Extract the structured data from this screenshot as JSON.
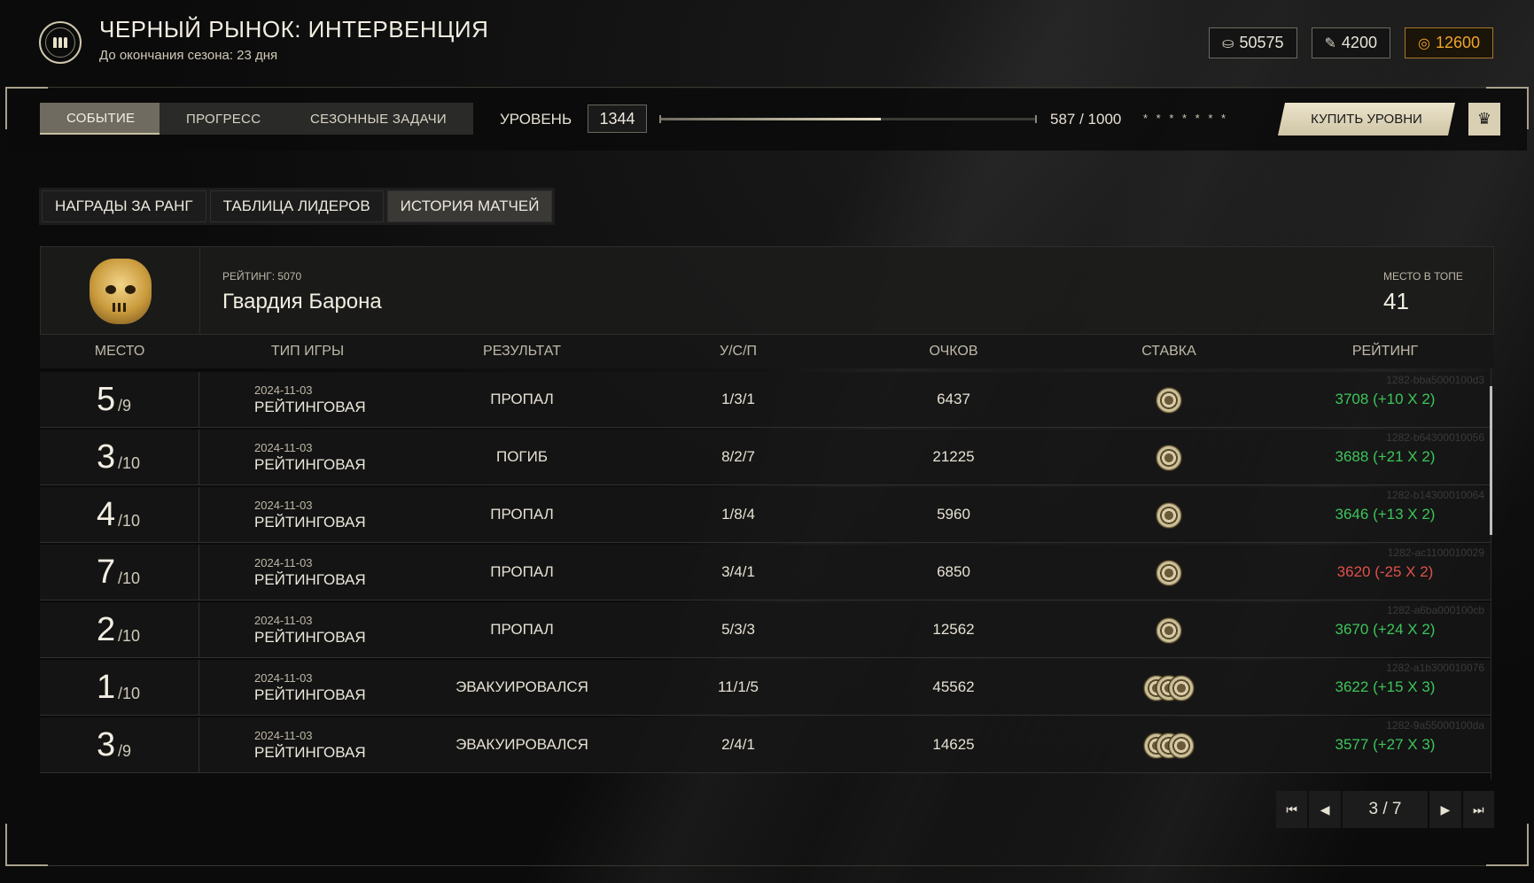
{
  "header": {
    "title": "ЧЕРНЫЙ РЫНОК: ИНТЕРВЕНЦИЯ",
    "subtitle": "До окончания сезона: 23 дня",
    "currencies": [
      {
        "icon": "tokens-icon",
        "value": "50575"
      },
      {
        "icon": "dogtag-icon",
        "value": "4200"
      },
      {
        "icon": "gold-coin-icon",
        "value": "12600",
        "color": "#f0a42c"
      }
    ]
  },
  "toolbar": {
    "tabs": [
      "СОБЫТИЕ",
      "ПРОГРЕСС",
      "СЕЗОННЫЕ ЗАДАЧИ"
    ],
    "active_tab": "СОБЫТИЕ",
    "level_label": "УРОВЕНЬ",
    "level_value": "1344",
    "progress_text": "587 / 1000",
    "progress_fraction": 0.587,
    "stars_text": "* * * * * * *",
    "buy_label": "КУПИТЬ УРОВНИ"
  },
  "subtabs": {
    "items": [
      "НАГРАДЫ ЗА РАНГ",
      "ТАБЛИЦА ЛИДЕРОВ",
      "ИСТОРИЯ МАТЧЕЙ"
    ],
    "active": "ИСТОРИЯ МАТЧЕЙ"
  },
  "profile": {
    "rating_label": "РЕЙТИНГ: 5070",
    "team_name": "Гвардия Барона",
    "place_label": "МЕСТО В ТОПЕ",
    "place_value": "41"
  },
  "table": {
    "headers": [
      "МЕСТО",
      "ТИП ИГРЫ",
      "РЕЗУЛЬТАТ",
      "У/С/П",
      "ОЧКОВ",
      "СТАВКА",
      "РЕЙТИНГ"
    ],
    "rows": [
      {
        "id": "1282-bba5000100d3",
        "place": "5",
        "total": "/9",
        "date": "2024-11-03",
        "type": "РЕЙТИНГОВАЯ",
        "result": "ПРОПАЛ",
        "ksa": "1/3/1",
        "score": "6437",
        "chips": 1,
        "rating": "3708 (+10 X 2)",
        "rating_positive": true
      },
      {
        "id": "1282-b64300010056",
        "place": "3",
        "total": "/10",
        "date": "2024-11-03",
        "type": "РЕЙТИНГОВАЯ",
        "result": "ПОГИБ",
        "ksa": "8/2/7",
        "score": "21225",
        "chips": 1,
        "rating": "3688 (+21 X 2)",
        "rating_positive": true
      },
      {
        "id": "1282-b14300010064",
        "place": "4",
        "total": "/10",
        "date": "2024-11-03",
        "type": "РЕЙТИНГОВАЯ",
        "result": "ПРОПАЛ",
        "ksa": "1/8/4",
        "score": "5960",
        "chips": 1,
        "rating": "3646 (+13 X 2)",
        "rating_positive": true
      },
      {
        "id": "1282-ac1100010029",
        "place": "7",
        "total": "/10",
        "date": "2024-11-03",
        "type": "РЕЙТИНГОВАЯ",
        "result": "ПРОПАЛ",
        "ksa": "3/4/1",
        "score": "6850",
        "chips": 1,
        "rating": "3620 (-25 X 2)",
        "rating_positive": false
      },
      {
        "id": "1282-a6ba000100cb",
        "place": "2",
        "total": "/10",
        "date": "2024-11-03",
        "type": "РЕЙТИНГОВАЯ",
        "result": "ПРОПАЛ",
        "ksa": "5/3/3",
        "score": "12562",
        "chips": 1,
        "rating": "3670 (+24 X 2)",
        "rating_positive": true
      },
      {
        "id": "1282-a1b300010076",
        "place": "1",
        "total": "/10",
        "date": "2024-11-03",
        "type": "РЕЙТИНГОВАЯ",
        "result": "ЭВАКУИРОВАЛСЯ",
        "ksa": "11/1/5",
        "score": "45562",
        "chips": 3,
        "rating": "3622 (+15 X 3)",
        "rating_positive": true
      },
      {
        "id": "1282-9a55000100da",
        "place": "3",
        "total": "/9",
        "date": "2024-11-03",
        "type": "РЕЙТИНГОВАЯ",
        "result": "ЭВАКУИРОВАЛСЯ",
        "ksa": "2/4/1",
        "score": "14625",
        "chips": 3,
        "rating": "3577 (+27 X 3)",
        "rating_positive": true
      }
    ]
  },
  "pager": {
    "page_text": "3 / 7",
    "first_icon": "first-page-icon",
    "prev_icon": "prev-page-icon",
    "next_icon": "next-page-icon",
    "last_icon": "last-page-icon"
  },
  "colors": {
    "positive": "#3cc55a",
    "negative": "#e2504a",
    "accent_gold": "#f0a42c"
  }
}
